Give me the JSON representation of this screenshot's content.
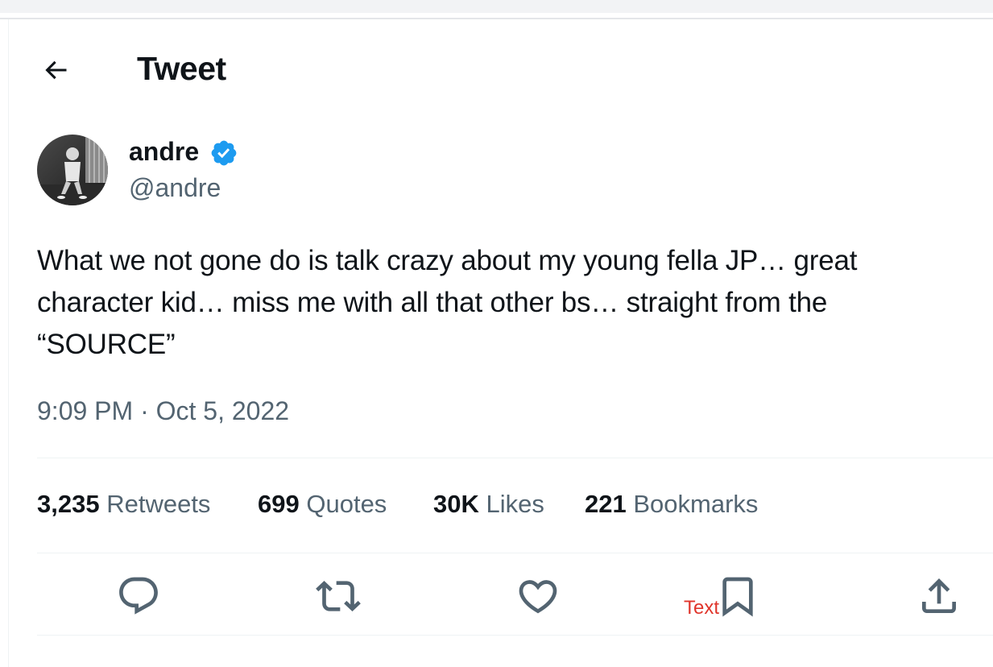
{
  "header": {
    "title": "Tweet"
  },
  "author": {
    "name": "andre",
    "handle": "@andre"
  },
  "tweet": {
    "lines": [
      "What we not gone do is talk crazy about my young fella JP… great",
      "character kid… miss me with all that other bs… straight from the",
      "“SOURCE”"
    ],
    "timestamp": "9:09 PM · Oct 5, 2022"
  },
  "stats": [
    {
      "count": "3,235",
      "label": "Retweets"
    },
    {
      "count": "699",
      "label": "Quotes"
    },
    {
      "count": "30K",
      "label": "Likes"
    },
    {
      "count": "221",
      "label": "Bookmarks"
    }
  ],
  "annotation": {
    "text": "Text"
  },
  "colors": {
    "text_primary": "#0f1419",
    "text_secondary": "#536471",
    "verified_blue": "#1d9bf0",
    "annotation_red": "#e0352b"
  },
  "icons": {
    "back": "arrow-left-icon",
    "verified": "verified-badge-icon",
    "reply": "reply-icon",
    "retweet": "retweet-icon",
    "like": "heart-icon",
    "bookmark": "bookmark-icon",
    "share": "share-icon"
  }
}
